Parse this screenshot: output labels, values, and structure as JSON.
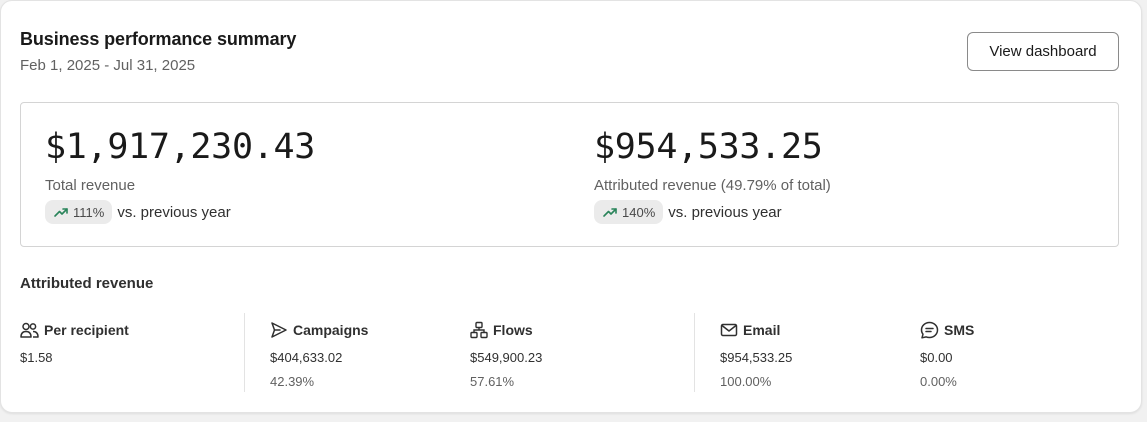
{
  "header": {
    "title": "Business performance summary",
    "date_range": "Feb 1, 2025 - Jul 31, 2025",
    "button_label": "View dashboard"
  },
  "kpis": [
    {
      "value": "$1,917,230.43",
      "label": "Total revenue",
      "change": "111%",
      "comparison": "vs. previous year",
      "trend": "up"
    },
    {
      "value": "$954,533.25",
      "label": "Attributed revenue (49.79% of total)",
      "change": "140%",
      "comparison": "vs. previous year",
      "trend": "up"
    }
  ],
  "attributed": {
    "title": "Attributed revenue",
    "metrics": [
      {
        "icon": "people-icon",
        "label": "Per recipient",
        "value": "$1.58"
      },
      {
        "icon": "send-icon",
        "label": "Campaigns",
        "value": "$404,633.02",
        "pct": "42.39%"
      },
      {
        "icon": "flow-icon",
        "label": "Flows",
        "value": "$549,900.23",
        "pct": "57.61%"
      },
      {
        "icon": "envelope-icon",
        "label": "Email",
        "value": "$954,533.25",
        "pct": "100.00%"
      },
      {
        "icon": "sms-icon",
        "label": "SMS",
        "value": "$0.00",
        "pct": "0.00%"
      }
    ]
  },
  "colors": {
    "trend_up": "#29845a",
    "pill_bg": "#ebebeb"
  }
}
